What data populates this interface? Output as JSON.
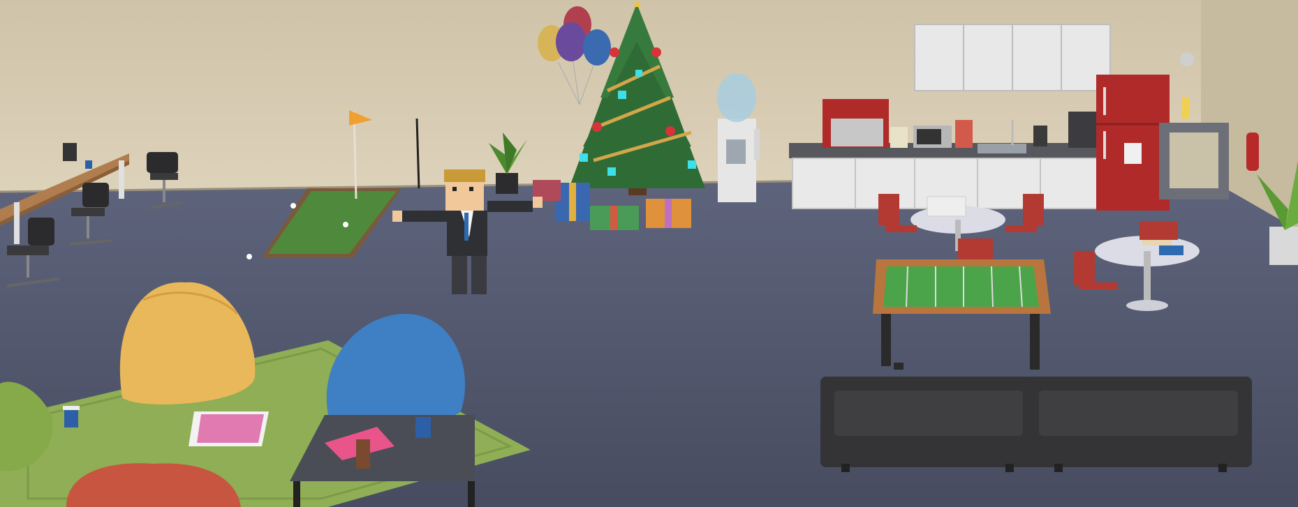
{
  "scene": {
    "kind": "3D low-poly office break room",
    "palette": {
      "wall": "#d6cbb3",
      "floor": "#545a72",
      "putting_green": "#4f8a3c",
      "rug": "#8fae55",
      "tree": "#2f6b35",
      "fridge": "#b02a2a",
      "cabinets": "#e8e8e8",
      "beanbag_yellow": "#e9b85a",
      "beanbag_blue": "#3f7fc4",
      "beanbag_red": "#c8553f",
      "beanbag_green": "#86a94a",
      "sofa": "#3a3a3c"
    },
    "objects": [
      {
        "name": "office-desk",
        "icon": "desk-icon"
      },
      {
        "name": "office-chair",
        "icon": "chair-icon"
      },
      {
        "name": "putting-green",
        "icon": "golf-flag-icon"
      },
      {
        "name": "potted-plant",
        "icon": "plant-icon"
      },
      {
        "name": "balloons",
        "icon": "balloon-icon"
      },
      {
        "name": "christmas-tree",
        "icon": "tree-icon"
      },
      {
        "name": "gift-box",
        "icon": "gift-icon"
      },
      {
        "name": "water-cooler",
        "icon": "water-cooler-icon"
      },
      {
        "name": "kitchen-cabinets",
        "icon": "cabinet-icon"
      },
      {
        "name": "espresso-machine",
        "icon": "coffee-machine-icon"
      },
      {
        "name": "microwave",
        "icon": "microwave-icon"
      },
      {
        "name": "fridge",
        "icon": "fridge-icon"
      },
      {
        "name": "vending-machine",
        "icon": "vending-icon"
      },
      {
        "name": "fire-extinguisher",
        "icon": "extinguisher-icon"
      },
      {
        "name": "round-table",
        "icon": "table-icon"
      },
      {
        "name": "foosball-table",
        "icon": "foosball-icon"
      },
      {
        "name": "sofa",
        "icon": "sofa-icon"
      },
      {
        "name": "bean-bag",
        "icon": "beanbag-icon"
      },
      {
        "name": "coffee-table",
        "icon": "coffee-table-icon"
      },
      {
        "name": "character",
        "icon": "person-icon"
      }
    ]
  }
}
